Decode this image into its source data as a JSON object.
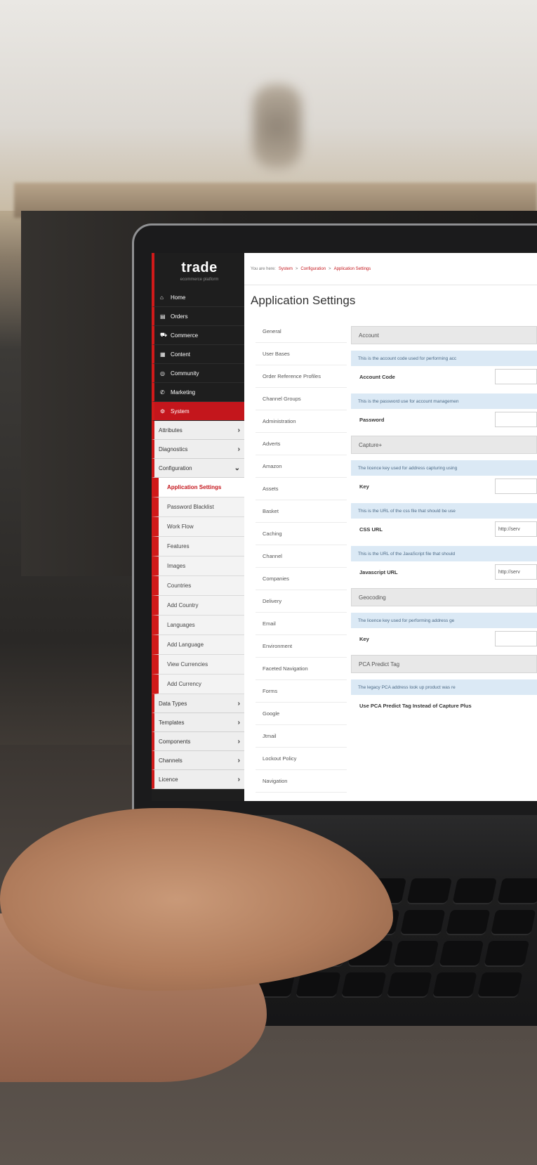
{
  "app": {
    "logo": {
      "main": "trade",
      "accent": "",
      "sub": "ecommerce platform"
    },
    "breadcrumb": {
      "prefix": "You are here:",
      "items": [
        "System",
        "Configuration",
        "Application Settings"
      ],
      "separator": ">"
    },
    "page_title": "Application Settings"
  },
  "sidebar": {
    "main_items": [
      {
        "label": "Home",
        "icon": "home-icon",
        "glyph": "⌂"
      },
      {
        "label": "Orders",
        "icon": "orders-icon",
        "glyph": "▤"
      },
      {
        "label": "Commerce",
        "icon": "cart-icon",
        "glyph": "⛟"
      },
      {
        "label": "Content",
        "icon": "content-icon",
        "glyph": "▦"
      },
      {
        "label": "Community",
        "icon": "community-icon",
        "glyph": "◎"
      },
      {
        "label": "Marketing",
        "icon": "marketing-icon",
        "glyph": "✆"
      },
      {
        "label": "System",
        "icon": "system-icon",
        "glyph": "⚙"
      }
    ],
    "system_items": [
      {
        "label": "Attributes",
        "chevron": "›"
      },
      {
        "label": "Diagnostics",
        "chevron": "›"
      },
      {
        "label": "Configuration",
        "chevron": "⌄"
      }
    ],
    "configuration_items": [
      "Application Settings",
      "Password Blacklist",
      "Work Flow",
      "Features",
      "Images",
      "Countries",
      "Add Country",
      "Languages",
      "Add Language",
      "View Currencies",
      "Add Currency"
    ],
    "bottom_items": [
      {
        "label": "Data Types",
        "chevron": "›"
      },
      {
        "label": "Templates",
        "chevron": "›"
      },
      {
        "label": "Components",
        "chevron": "›"
      },
      {
        "label": "Channels",
        "chevron": "›"
      },
      {
        "label": "Licence",
        "chevron": "›"
      }
    ]
  },
  "settings_nav": [
    "General",
    "User Bases",
    "Order Reference Profiles",
    "Channel Groups",
    "Administration",
    "Adverts",
    "Amazon",
    "Assets",
    "Basket",
    "Caching",
    "Channel",
    "Companies",
    "Delivery",
    "Email",
    "Environment",
    "Faceted Navigation",
    "Forms",
    "Google",
    "Jtmail",
    "Lockout Policy",
    "Navigation"
  ],
  "panel": {
    "account": {
      "title": "Account",
      "account_code_info": "This is the account code used for performing acc",
      "account_code_label": "Account Code",
      "password_info": "This is the password use for account managemen",
      "password_label": "Password"
    },
    "capture": {
      "title": "Capture+",
      "key_info": "The licence key used for address capturing using",
      "key_label": "Key",
      "css_info": "This is the URL of the css file that should be use",
      "css_label": "CSS URL",
      "css_value": "http://serv",
      "js_info": "This is the URL of the JavaScript file that should",
      "js_label": "Javascript URL",
      "js_value": "http://serv"
    },
    "geocoding": {
      "title": "Geocoding",
      "key_info": "The licence key used for performing address ge",
      "key_label": "Key"
    },
    "pca": {
      "title": "PCA Predict Tag",
      "info": "The legacy PCA address look up product was re",
      "label": "Use PCA Predict Tag Instead of Capture Plus"
    }
  }
}
